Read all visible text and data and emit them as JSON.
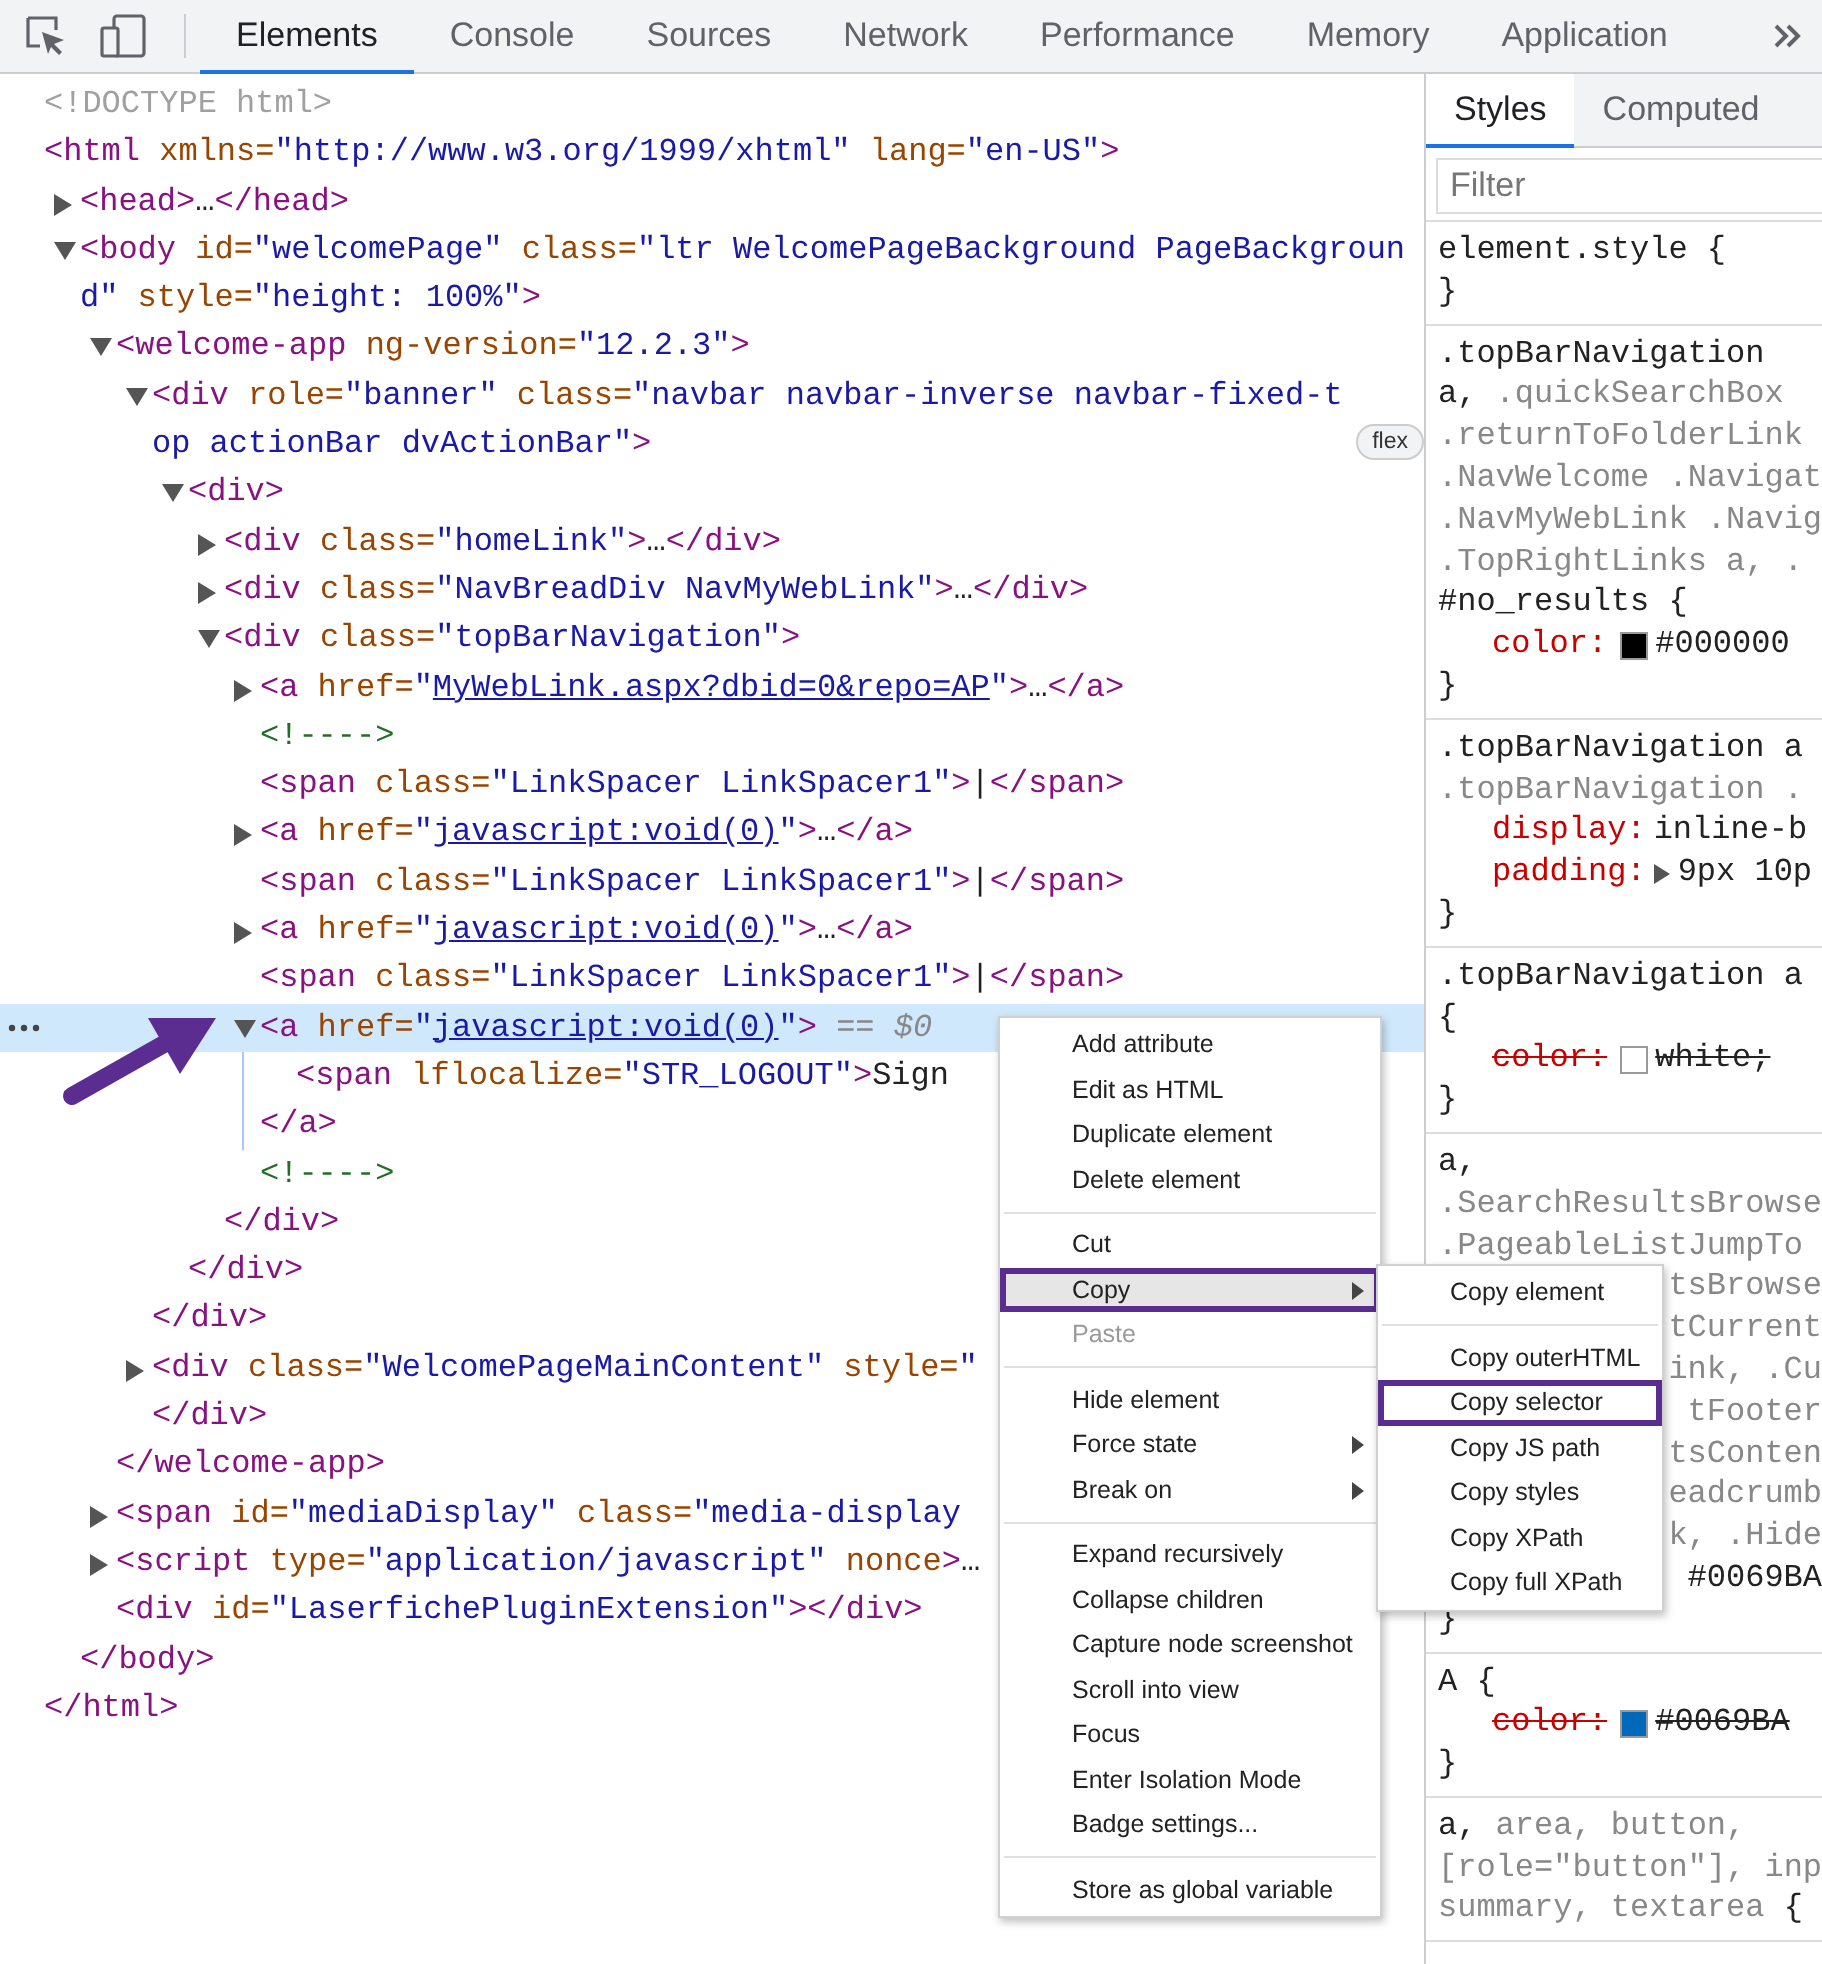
{
  "toolbar": {
    "tabs": [
      {
        "label": "Elements",
        "selected": true
      },
      {
        "label": "Console",
        "selected": false
      },
      {
        "label": "Sources",
        "selected": false
      },
      {
        "label": "Network",
        "selected": false
      },
      {
        "label": "Performance",
        "selected": false
      },
      {
        "label": "Memory",
        "selected": false
      },
      {
        "label": "Application",
        "selected": false
      }
    ]
  },
  "dom_tree": [
    {
      "selected": false,
      "open": [
        {
          "kind": "doctype",
          "text": "<!DOCTYPE html>"
        }
      ]
    },
    {
      "selected": false,
      "open": [
        {
          "kind": "tag",
          "text": "<html"
        },
        {
          "kind": "attr",
          "text": " xmlns="
        },
        {
          "kind": "value",
          "text": "\"http://www.w3.org/1999/xhtml\""
        },
        {
          "kind": "attr",
          "text": " lang="
        },
        {
          "kind": "value",
          "text": "\"en-US\""
        },
        {
          "kind": "tag",
          "text": ">"
        }
      ],
      "close": [
        {
          "kind": "tag",
          "text": "</html>"
        }
      ],
      "children": [
        {
          "selected": false,
          "expanded": false,
          "open": [
            {
              "kind": "tag",
              "text": "<head>"
            },
            {
              "kind": "text",
              "text": "…"
            },
            {
              "kind": "tag",
              "text": "</head>"
            }
          ]
        },
        {
          "selected": false,
          "expanded": true,
          "open": [
            {
              "kind": "tag",
              "text": "<body"
            },
            {
              "kind": "attr",
              "text": " id="
            },
            {
              "kind": "value",
              "text": "\"welcomePage\""
            },
            {
              "kind": "attr",
              "text": " class="
            },
            {
              "kind": "value",
              "text": "\"ltr WelcomePageBackground PageBackground\""
            },
            {
              "kind": "attr",
              "text": " style="
            },
            {
              "kind": "value",
              "text": "\"height: 100%\""
            },
            {
              "kind": "tag",
              "text": ">"
            }
          ],
          "close": [
            {
              "kind": "tag",
              "text": "</body>"
            }
          ],
          "children": [
            {
              "selected": false,
              "expanded": true,
              "open": [
                {
                  "kind": "tag",
                  "text": "<welcome-app"
                },
                {
                  "kind": "attr",
                  "text": " ng-version="
                },
                {
                  "kind": "value",
                  "text": "\"12.2.3\""
                },
                {
                  "kind": "tag",
                  "text": ">"
                }
              ],
              "close": [
                {
                  "kind": "tag",
                  "text": "</welcome-app>"
                }
              ],
              "children": [
                {
                  "selected": false,
                  "expanded": true,
                  "open": [
                    {
                      "kind": "tag",
                      "text": "<div"
                    },
                    {
                      "kind": "attr",
                      "text": " role="
                    },
                    {
                      "kind": "value",
                      "text": "\"banner\""
                    },
                    {
                      "kind": "attr",
                      "text": " class="
                    },
                    {
                      "kind": "value",
                      "text": "\"navbar navbar-inverse navbar-fixed-top actionBar dvActionBar\""
                    },
                    {
                      "kind": "tag",
                      "text": ">"
                    },
                    {
                      "kind": "badge",
                      "text": "flex"
                    }
                  ],
                  "close": [
                    {
                      "kind": "tag",
                      "text": "</div>"
                    }
                  ],
                  "children": [
                    {
                      "selected": false,
                      "expanded": true,
                      "open": [
                        {
                          "kind": "tag",
                          "text": "<div>"
                        }
                      ],
                      "close": [
                        {
                          "kind": "tag",
                          "text": "</div>"
                        }
                      ],
                      "children": [
                        {
                          "selected": false,
                          "expanded": false,
                          "open": [
                            {
                              "kind": "tag",
                              "text": "<div"
                            },
                            {
                              "kind": "attr",
                              "text": " class="
                            },
                            {
                              "kind": "value",
                              "text": "\"homeLink\""
                            },
                            {
                              "kind": "tag",
                              "text": ">"
                            },
                            {
                              "kind": "text",
                              "text": "…"
                            },
                            {
                              "kind": "tag",
                              "text": "</div>"
                            }
                          ]
                        },
                        {
                          "selected": false,
                          "expanded": false,
                          "open": [
                            {
                              "kind": "tag",
                              "text": "<div"
                            },
                            {
                              "kind": "attr",
                              "text": " class="
                            },
                            {
                              "kind": "value",
                              "text": "\"NavBreadDiv NavMyWebLink\""
                            },
                            {
                              "kind": "tag",
                              "text": ">"
                            },
                            {
                              "kind": "text",
                              "text": "…"
                            },
                            {
                              "kind": "tag",
                              "text": "</div>"
                            }
                          ]
                        },
                        {
                          "selected": false,
                          "expanded": true,
                          "open": [
                            {
                              "kind": "tag",
                              "text": "<div"
                            },
                            {
                              "kind": "attr",
                              "text": " class="
                            },
                            {
                              "kind": "value",
                              "text": "\"topBarNavigation\""
                            },
                            {
                              "kind": "tag",
                              "text": ">"
                            }
                          ],
                          "close": [
                            {
                              "kind": "tag",
                              "text": "</div>"
                            }
                          ],
                          "children": [
                            {
                              "selected": false,
                              "expanded": false,
                              "open": [
                                {
                                  "kind": "tag",
                                  "text": "<a"
                                },
                                {
                                  "kind": "attr",
                                  "text": " href="
                                },
                                {
                                  "kind": "value",
                                  "text": "\""
                                },
                                {
                                  "kind": "link",
                                  "text": "MyWebLink.aspx?dbid=0&repo=AP"
                                },
                                {
                                  "kind": "value",
                                  "text": "\""
                                },
                                {
                                  "kind": "tag",
                                  "text": ">"
                                },
                                {
                                  "kind": "text",
                                  "text": "…"
                                },
                                {
                                  "kind": "tag",
                                  "text": "</a>"
                                }
                              ]
                            },
                            {
                              "selected": false,
                              "open": [
                                {
                                  "kind": "comment",
                                  "text": "<!---->"
                                }
                              ]
                            },
                            {
                              "selected": false,
                              "open": [
                                {
                                  "kind": "tag",
                                  "text": "<span"
                                },
                                {
                                  "kind": "attr",
                                  "text": " class="
                                },
                                {
                                  "kind": "value",
                                  "text": "\"LinkSpacer LinkSpacer1\""
                                },
                                {
                                  "kind": "tag",
                                  "text": ">"
                                },
                                {
                                  "kind": "text",
                                  "text": "|"
                                },
                                {
                                  "kind": "tag",
                                  "text": "</span>"
                                }
                              ]
                            },
                            {
                              "selected": false,
                              "expanded": false,
                              "open": [
                                {
                                  "kind": "tag",
                                  "text": "<a"
                                },
                                {
                                  "kind": "attr",
                                  "text": " href="
                                },
                                {
                                  "kind": "value",
                                  "text": "\""
                                },
                                {
                                  "kind": "link",
                                  "text": "javascript:void(0)"
                                },
                                {
                                  "kind": "value",
                                  "text": "\""
                                },
                                {
                                  "kind": "tag",
                                  "text": ">"
                                },
                                {
                                  "kind": "text",
                                  "text": "…"
                                },
                                {
                                  "kind": "tag",
                                  "text": "</a>"
                                }
                              ]
                            },
                            {
                              "selected": false,
                              "open": [
                                {
                                  "kind": "tag",
                                  "text": "<span"
                                },
                                {
                                  "kind": "attr",
                                  "text": " class="
                                },
                                {
                                  "kind": "value",
                                  "text": "\"LinkSpacer LinkSpacer1\""
                                },
                                {
                                  "kind": "tag",
                                  "text": ">"
                                },
                                {
                                  "kind": "text",
                                  "text": "|"
                                },
                                {
                                  "kind": "tag",
                                  "text": "</span>"
                                }
                              ]
                            },
                            {
                              "selected": false,
                              "expanded": false,
                              "open": [
                                {
                                  "kind": "tag",
                                  "text": "<a"
                                },
                                {
                                  "kind": "attr",
                                  "text": " href="
                                },
                                {
                                  "kind": "value",
                                  "text": "\""
                                },
                                {
                                  "kind": "link",
                                  "text": "javascript:void(0)"
                                },
                                {
                                  "kind": "value",
                                  "text": "\""
                                },
                                {
                                  "kind": "tag",
                                  "text": ">"
                                },
                                {
                                  "kind": "text",
                                  "text": "…"
                                },
                                {
                                  "kind": "tag",
                                  "text": "</a>"
                                }
                              ]
                            },
                            {
                              "selected": false,
                              "open": [
                                {
                                  "kind": "tag",
                                  "text": "<span"
                                },
                                {
                                  "kind": "attr",
                                  "text": " class="
                                },
                                {
                                  "kind": "value",
                                  "text": "\"LinkSpacer LinkSpacer1\""
                                },
                                {
                                  "kind": "tag",
                                  "text": ">"
                                },
                                {
                                  "kind": "text",
                                  "text": "|"
                                },
                                {
                                  "kind": "tag",
                                  "text": "</span>"
                                }
                              ]
                            },
                            {
                              "selected": true,
                              "expanded": true,
                              "open": [
                                {
                                  "kind": "tag",
                                  "text": "<a"
                                },
                                {
                                  "kind": "attr",
                                  "text": " href="
                                },
                                {
                                  "kind": "value",
                                  "text": "\""
                                },
                                {
                                  "kind": "link",
                                  "text": "javascript:void(0)"
                                },
                                {
                                  "kind": "value",
                                  "text": "\""
                                },
                                {
                                  "kind": "tag",
                                  "text": ">"
                                },
                                {
                                  "kind": "ref",
                                  "text": " == $0"
                                }
                              ],
                              "close": [
                                {
                                  "kind": "tag",
                                  "text": "</a>"
                                }
                              ],
                              "children": [
                                {
                                  "selected": false,
                                  "open": [
                                    {
                                      "kind": "tag",
                                      "text": "<span"
                                    },
                                    {
                                      "kind": "attr",
                                      "text": " lflocalize="
                                    },
                                    {
                                      "kind": "value",
                                      "text": "\"STR_LOGOUT\""
                                    },
                                    {
                                      "kind": "tag",
                                      "text": ">"
                                    },
                                    {
                                      "kind": "text",
                                      "text": "Sign"
                                    }
                                  ]
                                }
                              ]
                            },
                            {
                              "selected": false,
                              "open": [
                                {
                                  "kind": "comment",
                                  "text": "<!---->"
                                }
                              ]
                            }
                          ]
                        }
                      ]
                    }
                  ]
                },
                {
                  "selected": false,
                  "expanded": false,
                  "open": [
                    {
                      "kind": "tag",
                      "text": "<div"
                    },
                    {
                      "kind": "attr",
                      "text": " class="
                    },
                    {
                      "kind": "value",
                      "text": "\"WelcomePageMainContent\""
                    },
                    {
                      "kind": "attr",
                      "text": " style="
                    },
                    {
                      "kind": "value",
                      "text": "\""
                    }
                  ],
                  "close": [
                    {
                      "kind": "tag",
                      "text": "</div>"
                    }
                  ]
                }
              ]
            },
            {
              "selected": false,
              "expanded": false,
              "open": [
                {
                  "kind": "tag",
                  "text": "<span"
                },
                {
                  "kind": "attr",
                  "text": " id="
                },
                {
                  "kind": "value",
                  "text": "\"mediaDisplay\""
                },
                {
                  "kind": "attr",
                  "text": " class="
                },
                {
                  "kind": "value",
                  "text": "\"media-display"
                }
              ]
            },
            {
              "selected": false,
              "expanded": false,
              "open": [
                {
                  "kind": "tag",
                  "text": "<script"
                },
                {
                  "kind": "attr",
                  "text": " type="
                },
                {
                  "kind": "value",
                  "text": "\"application/javascript\""
                },
                {
                  "kind": "attr",
                  "text": " nonce"
                },
                {
                  "kind": "tag",
                  "text": ">"
                },
                {
                  "kind": "text",
                  "text": "…"
                }
              ]
            },
            {
              "selected": false,
              "open": [
                {
                  "kind": "tag",
                  "text": "<div"
                },
                {
                  "kind": "attr",
                  "text": " id="
                },
                {
                  "kind": "value",
                  "text": "\"LaserfichePluginExtension\""
                },
                {
                  "kind": "tag",
                  "text": ">"
                },
                {
                  "kind": "tag",
                  "text": "</div>"
                }
              ]
            }
          ]
        }
      ]
    }
  ],
  "context_menu": {
    "items": [
      {
        "kind": "item",
        "label": "Add attribute",
        "disabled": false,
        "submenu": false,
        "selected": false,
        "annotated": false
      },
      {
        "kind": "item",
        "label": "Edit as HTML",
        "disabled": false,
        "submenu": false,
        "selected": false,
        "annotated": false
      },
      {
        "kind": "item",
        "label": "Duplicate element",
        "disabled": false,
        "submenu": false,
        "selected": false,
        "annotated": false
      },
      {
        "kind": "item",
        "label": "Delete element",
        "disabled": false,
        "submenu": false,
        "selected": false,
        "annotated": false
      },
      {
        "kind": "separator"
      },
      {
        "kind": "item",
        "label": "Cut",
        "disabled": false,
        "submenu": false,
        "selected": false,
        "annotated": false
      },
      {
        "kind": "item",
        "label": "Copy",
        "disabled": false,
        "submenu": true,
        "selected": true,
        "annotated": true
      },
      {
        "kind": "item",
        "label": "Paste",
        "disabled": true,
        "submenu": false,
        "selected": false,
        "annotated": false
      },
      {
        "kind": "separator"
      },
      {
        "kind": "item",
        "label": "Hide element",
        "disabled": false,
        "submenu": false,
        "selected": false,
        "annotated": false
      },
      {
        "kind": "item",
        "label": "Force state",
        "disabled": false,
        "submenu": true,
        "selected": false,
        "annotated": false
      },
      {
        "kind": "item",
        "label": "Break on",
        "disabled": false,
        "submenu": true,
        "selected": false,
        "annotated": false
      },
      {
        "kind": "separator"
      },
      {
        "kind": "item",
        "label": "Expand recursively",
        "disabled": false,
        "submenu": false,
        "selected": false,
        "annotated": false
      },
      {
        "kind": "item",
        "label": "Collapse children",
        "disabled": false,
        "submenu": false,
        "selected": false,
        "annotated": false
      },
      {
        "kind": "item",
        "label": "Capture node screenshot",
        "disabled": false,
        "submenu": false,
        "selected": false,
        "annotated": false
      },
      {
        "kind": "item",
        "label": "Scroll into view",
        "disabled": false,
        "submenu": false,
        "selected": false,
        "annotated": false
      },
      {
        "kind": "item",
        "label": "Focus",
        "disabled": false,
        "submenu": false,
        "selected": false,
        "annotated": false
      },
      {
        "kind": "item",
        "label": "Enter Isolation Mode",
        "disabled": false,
        "submenu": false,
        "selected": false,
        "annotated": false
      },
      {
        "kind": "item",
        "label": "Badge settings...",
        "disabled": false,
        "submenu": false,
        "selected": false,
        "annotated": false
      },
      {
        "kind": "separator"
      },
      {
        "kind": "item",
        "label": "Store as global variable",
        "disabled": false,
        "submenu": false,
        "selected": false,
        "annotated": false
      }
    ],
    "submenu": {
      "items": [
        {
          "kind": "item",
          "label": "Copy element",
          "disabled": false,
          "submenu": false,
          "selected": false,
          "annotated": false
        },
        {
          "kind": "separator"
        },
        {
          "kind": "item",
          "label": "Copy outerHTML",
          "disabled": false,
          "submenu": false,
          "selected": false,
          "annotated": false
        },
        {
          "kind": "item",
          "label": "Copy selector",
          "disabled": false,
          "submenu": false,
          "selected": false,
          "annotated": true
        },
        {
          "kind": "item",
          "label": "Copy JS path",
          "disabled": false,
          "submenu": false,
          "selected": false,
          "annotated": false
        },
        {
          "kind": "item",
          "label": "Copy styles",
          "disabled": false,
          "submenu": false,
          "selected": false,
          "annotated": false
        },
        {
          "kind": "item",
          "label": "Copy XPath",
          "disabled": false,
          "submenu": false,
          "selected": false,
          "annotated": false
        },
        {
          "kind": "item",
          "label": "Copy full XPath",
          "disabled": false,
          "submenu": false,
          "selected": false,
          "annotated": false
        }
      ]
    }
  },
  "styles_pane": {
    "tabs": [
      {
        "label": "Styles",
        "selected": true
      },
      {
        "label": "Computed",
        "selected": false
      }
    ],
    "filter": {
      "placeholder": "Filter"
    },
    "rules": [
      {
        "lines": [
          {
            "kind": "sel",
            "segs": [
              {
                "kind": "selector",
                "text": "element.style {"
              }
            ]
          },
          {
            "kind": "sel",
            "segs": [
              {
                "kind": "selector",
                "text": "}"
              }
            ]
          }
        ]
      },
      {
        "lines": [
          {
            "kind": "sel",
            "segs": [
              {
                "kind": "selector",
                "text": ".topBarNavigation"
              }
            ]
          },
          {
            "kind": "sel",
            "segs": [
              {
                "kind": "selector",
                "text": "a,"
              },
              {
                "kind": "selector_dim",
                "text": " .quickSearchBox"
              }
            ]
          },
          {
            "kind": "sel",
            "segs": [
              {
                "kind": "selector_dim",
                "text": ".returnToFolderLink"
              }
            ]
          },
          {
            "kind": "sel",
            "segs": [
              {
                "kind": "selector_dim",
                "text": ".NavWelcome .Navigat"
              }
            ]
          },
          {
            "kind": "sel",
            "segs": [
              {
                "kind": "selector_dim",
                "text": ".NavMyWebLink .Navig"
              }
            ]
          },
          {
            "kind": "sel",
            "segs": [
              {
                "kind": "selector_dim",
                "text": ".TopRightLinks a, ."
              }
            ]
          },
          {
            "kind": "sel",
            "segs": [
              {
                "kind": "selector",
                "text": "#no_results {"
              }
            ]
          },
          {
            "kind": "decl",
            "struck": false,
            "segs": [
              {
                "kind": "property",
                "text": "color:"
              },
              {
                "kind": "swatch",
                "color": "#000000"
              },
              {
                "kind": "value",
                "text": "#000000"
              }
            ]
          },
          {
            "kind": "sel",
            "segs": [
              {
                "kind": "selector",
                "text": "}"
              }
            ]
          }
        ]
      },
      {
        "lines": [
          {
            "kind": "sel",
            "segs": [
              {
                "kind": "selector",
                "text": ".topBarNavigation a"
              }
            ]
          },
          {
            "kind": "sel",
            "segs": [
              {
                "kind": "selector_dim",
                "text": ".topBarNavigation ."
              }
            ]
          },
          {
            "kind": "decl",
            "struck": false,
            "segs": [
              {
                "kind": "property",
                "text": "display:"
              },
              {
                "kind": "value",
                "text": "inline-b"
              }
            ]
          },
          {
            "kind": "decl",
            "struck": false,
            "segs": [
              {
                "kind": "property",
                "text": "padding:"
              },
              {
                "kind": "caret"
              },
              {
                "kind": "value",
                "text": "9px 10p"
              }
            ]
          },
          {
            "kind": "sel",
            "segs": [
              {
                "kind": "selector",
                "text": "}"
              }
            ]
          }
        ]
      },
      {
        "lines": [
          {
            "kind": "sel",
            "segs": [
              {
                "kind": "selector",
                "text": ".topBarNavigation a"
              }
            ]
          },
          {
            "kind": "sel",
            "segs": [
              {
                "kind": "selector",
                "text": "{"
              }
            ]
          },
          {
            "kind": "decl",
            "struck": true,
            "segs": [
              {
                "kind": "property",
                "text": "color:"
              },
              {
                "kind": "swatch",
                "color": "#ffffff"
              },
              {
                "kind": "value",
                "text": "white;"
              }
            ]
          },
          {
            "kind": "sel",
            "segs": [
              {
                "kind": "selector",
                "text": "}"
              }
            ]
          }
        ]
      },
      {
        "lines": [
          {
            "kind": "sel",
            "segs": [
              {
                "kind": "selector",
                "text": "a,"
              }
            ]
          },
          {
            "kind": "sel",
            "segs": [
              {
                "kind": "selector_dim",
                "text": ".SearchResultsBrowse"
              }
            ]
          },
          {
            "kind": "sel",
            "segs": [
              {
                "kind": "selector_dim",
                "text": ".PageableListJumpTo"
              }
            ]
          },
          {
            "kind": "covered",
            "segs": [
              {
                "kind": "selector_dim",
                "text": "tsBrowse"
              }
            ]
          },
          {
            "kind": "covered",
            "segs": [
              {
                "kind": "selector_dim",
                "text": "tCurrent"
              }
            ]
          },
          {
            "kind": "covered",
            "segs": [
              {
                "kind": "selector_dim",
                "text": "ink, .Cu"
              }
            ]
          },
          {
            "kind": "covered",
            "segs": [
              {
                "kind": "selector_dim",
                "text": "tFooter"
              }
            ]
          },
          {
            "kind": "covered",
            "segs": [
              {
                "kind": "selector_dim",
                "text": "tsConten"
              }
            ]
          },
          {
            "kind": "covered",
            "segs": [
              {
                "kind": "selector_dim",
                "text": "eadcrumb"
              }
            ]
          },
          {
            "kind": "covered",
            "segs": [
              {
                "kind": "selector_dim",
                "text": "k, .Hide"
              }
            ]
          },
          {
            "kind": "covered",
            "segs": [
              {
                "kind": "value",
                "text": "#0069BA"
              }
            ]
          },
          {
            "kind": "sel",
            "segs": [
              {
                "kind": "selector",
                "text": "}"
              }
            ]
          }
        ]
      },
      {
        "lines": [
          {
            "kind": "sel",
            "segs": [
              {
                "kind": "selector",
                "text": "A {"
              }
            ]
          },
          {
            "kind": "decl",
            "struck": true,
            "segs": [
              {
                "kind": "property",
                "text": "color:"
              },
              {
                "kind": "swatch",
                "color": "#0069ba"
              },
              {
                "kind": "value",
                "text": "#0069BA"
              }
            ]
          },
          {
            "kind": "sel",
            "segs": [
              {
                "kind": "selector",
                "text": "}"
              }
            ]
          }
        ]
      },
      {
        "lines": [
          {
            "kind": "sel",
            "segs": [
              {
                "kind": "selector",
                "text": "a,"
              },
              {
                "kind": "selector_dim",
                "text": " area, button,"
              }
            ]
          },
          {
            "kind": "sel",
            "segs": [
              {
                "kind": "selector_dim",
                "text": "[role=\"button\"], inp"
              }
            ]
          },
          {
            "kind": "sel",
            "segs": [
              {
                "kind": "selector_dim",
                "text": "summary, textarea"
              },
              {
                "kind": "selector",
                "text": " {"
              }
            ]
          }
        ]
      }
    ]
  }
}
